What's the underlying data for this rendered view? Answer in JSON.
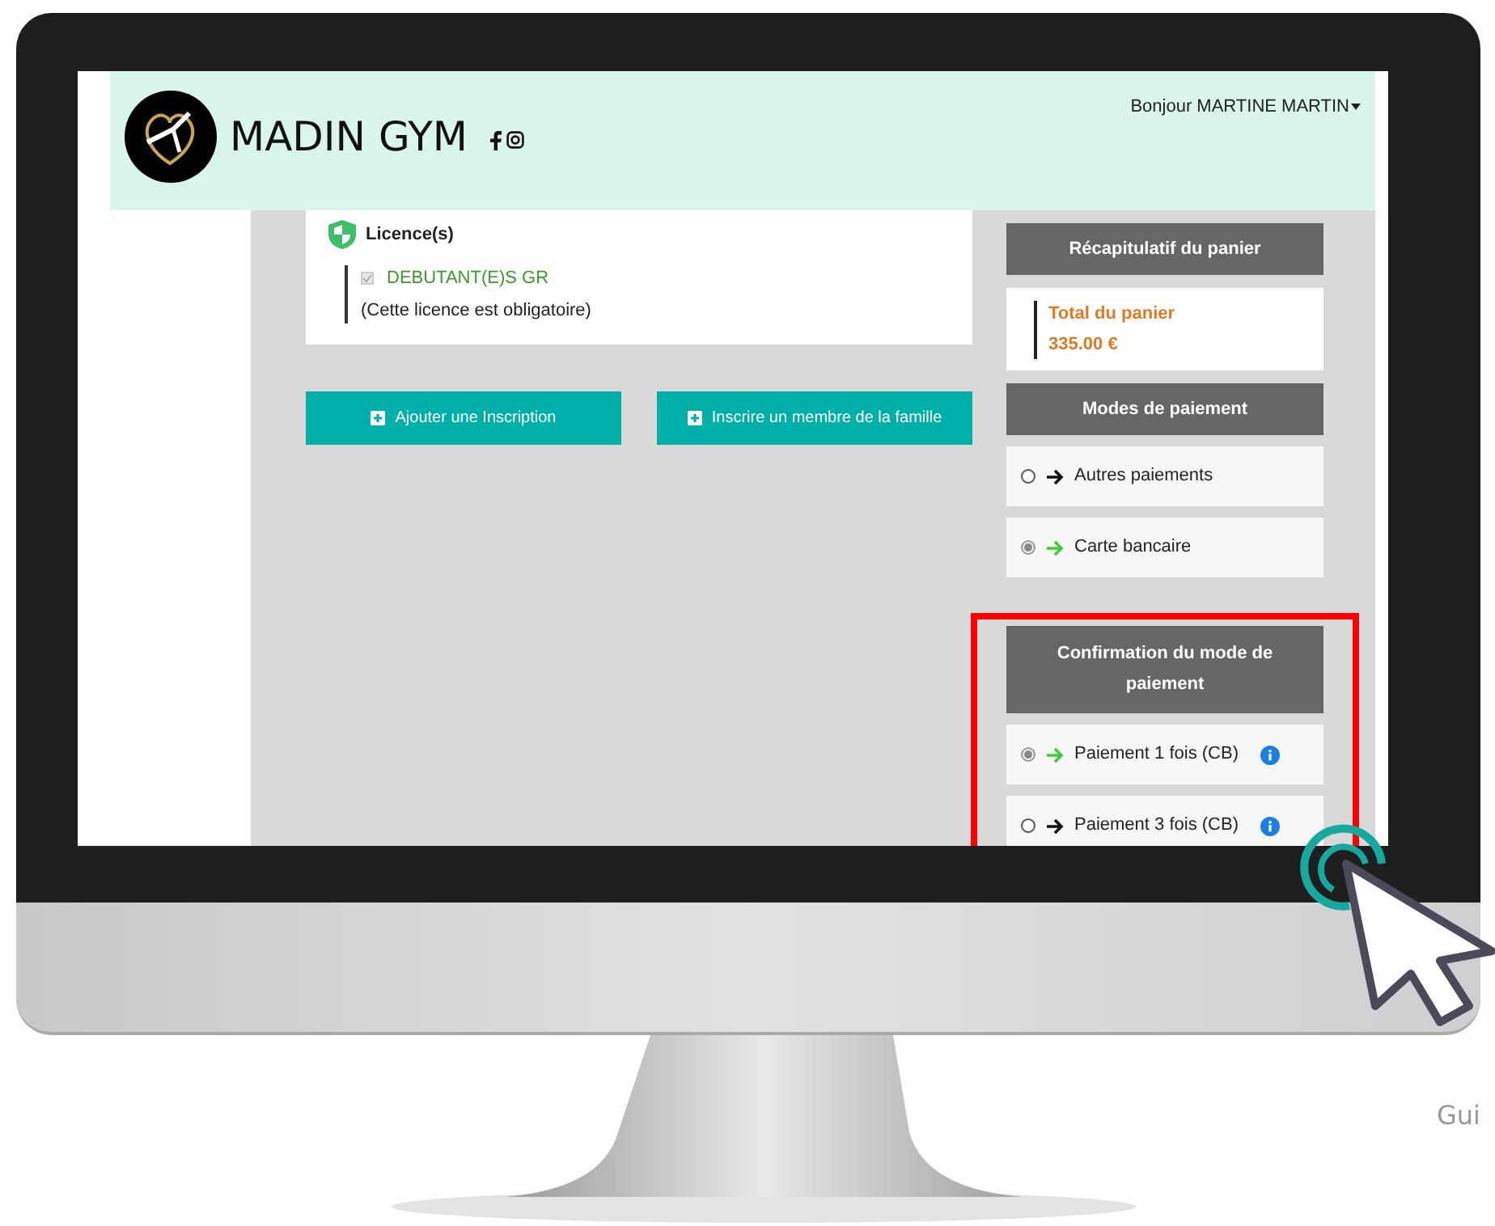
{
  "header": {
    "brand": "MADIN GYM",
    "user_menu": "Bonjour MARTINE MARTIN"
  },
  "licences": {
    "title": "Licence(s)",
    "items": [
      {
        "name": "DEBUTANT(E)S GR",
        "checked": true,
        "disabled": true,
        "note": "(Cette licence est obligatoire)"
      }
    ]
  },
  "buttons": [
    "Ajouter une Inscription",
    "Inscrire un membre de la famille"
  ],
  "cart": {
    "title": "Récapitulatif du panier",
    "total_label": "Total du panier",
    "total": "335.00 €"
  },
  "payment_modes": {
    "title": "Modes de paiement",
    "highlighted": false,
    "options": [
      {
        "label": "Autres paiements",
        "selected": false,
        "info": false
      },
      {
        "label": "Carte bancaire",
        "selected": true,
        "info": false
      }
    ]
  },
  "payment_confirmation": {
    "title": "Confirmation du mode de paiement",
    "highlighted": true,
    "options": [
      {
        "label": "Paiement 1 fois (CB)",
        "selected": true,
        "info": true
      },
      {
        "label": "Paiement 3 fois (CB)",
        "selected": false,
        "info": true
      }
    ]
  },
  "caption": "Gui"
}
